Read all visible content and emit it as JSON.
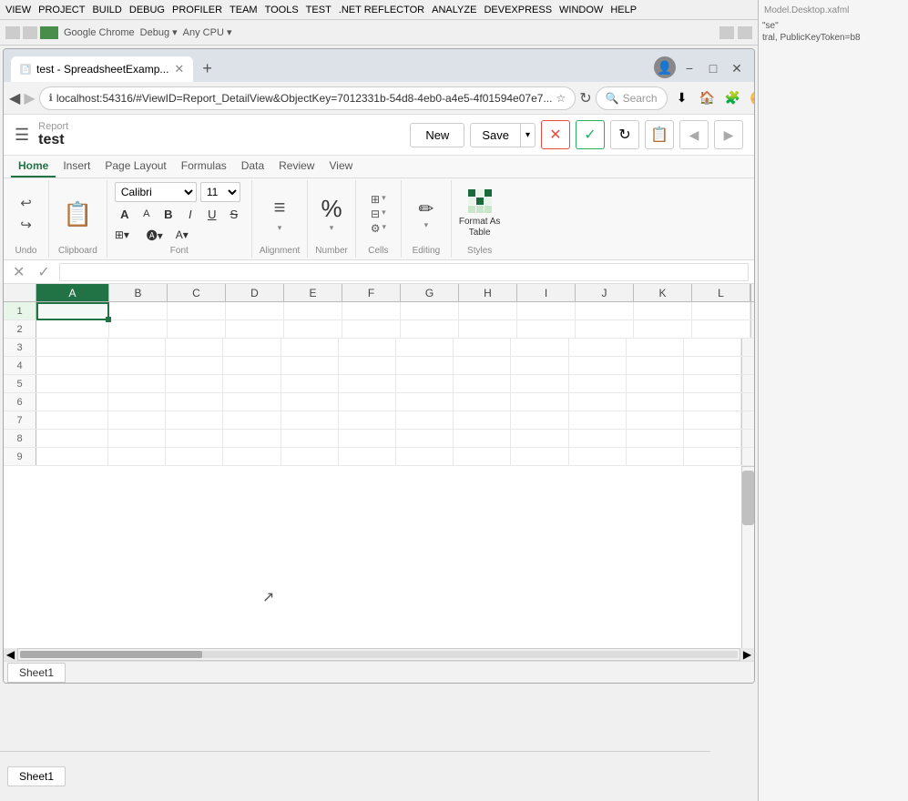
{
  "browser": {
    "tab_title": "test - SpreadsheetExamp...",
    "new_tab_label": "+",
    "url": "localhost:54316/#ViewID=Report_DetailView&ObjectKey=7012331b-54d8-4eb0-a4e5-4f01594e07e7...",
    "search_placeholder": "Search"
  },
  "report": {
    "label": "Report",
    "name": "test",
    "actions": {
      "new_label": "New",
      "save_label": "Save"
    }
  },
  "ribbon": {
    "tabs": [
      "Home",
      "Insert",
      "Page Layout",
      "Formulas",
      "Data",
      "Review",
      "View"
    ],
    "active_tab": "Home",
    "font": {
      "family": "Calibri",
      "size": "11"
    },
    "groups": {
      "undo": {
        "label": "Undo"
      },
      "clipboard": {
        "label": "Clipboard"
      },
      "font": {
        "label": "Font"
      },
      "alignment": {
        "label": "Alignment"
      },
      "number": {
        "label": "Number"
      },
      "cells": {
        "label": "Cells"
      },
      "editing": {
        "label": "Editing"
      },
      "styles": {
        "label": "Styles"
      }
    },
    "editing_label": "Editing",
    "format_as_table_label": "Format As\nTable"
  },
  "formula_bar": {
    "cancel": "✕",
    "confirm": "✓"
  },
  "grid": {
    "columns": [
      "A",
      "B",
      "C",
      "D",
      "E",
      "F",
      "G",
      "H",
      "I",
      "J",
      "K",
      "L"
    ],
    "rows": [
      1,
      2,
      3,
      4,
      5,
      6,
      7,
      8,
      9
    ],
    "selected_cell": "A1"
  },
  "sheet_tabs": [
    {
      "label": "Sheet1",
      "active": true
    }
  ],
  "os": {
    "minimize": "−",
    "maximize": "□",
    "close": "✕"
  }
}
